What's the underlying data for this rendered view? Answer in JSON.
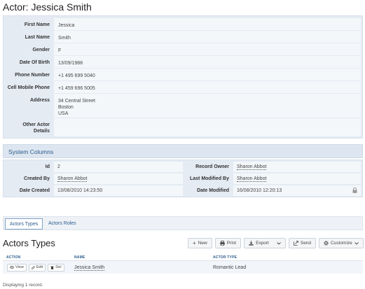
{
  "page_title": "Actor: Jessica Smith",
  "details": [
    {
      "label": "First Name",
      "value": "Jessica"
    },
    {
      "label": "Last Name",
      "value": "Smith"
    },
    {
      "label": "Gender",
      "value": "F"
    },
    {
      "label": "Date Of Birth",
      "value": "13/09/1988"
    },
    {
      "label": "Phone Number",
      "value": "+1 495 699 5040"
    },
    {
      "label": "Cell Mobile Phone",
      "value": "+1 459 696 5005"
    },
    {
      "label": "Address",
      "value_lines": [
        "34 Central Street",
        "Boston",
        "USA"
      ]
    },
    {
      "label": "Other Actor Details",
      "value": ""
    }
  ],
  "system": {
    "header": "System Columns",
    "rows": [
      {
        "label": "Id",
        "value": "2",
        "label2": "Record Owner",
        "value2": "Sharon Abbot"
      },
      {
        "label": "Created By",
        "value": "Sharon Abbot",
        "label2": "Last Modified By",
        "value2": "Sharon Abbot"
      },
      {
        "label": "Date Created",
        "value": "13/08/2010 14:23:50",
        "label2": "Date Modified",
        "value2": "16/08/2010 12:20:13"
      }
    ]
  },
  "tabs": [
    {
      "label": "Actors Types",
      "active": true
    },
    {
      "label": "Actors Roles",
      "active": false
    }
  ],
  "section_title": "Actors Types",
  "toolbar": {
    "new": "New",
    "print": "Print",
    "export": "Export",
    "send": "Send",
    "customize": "Customize"
  },
  "grid": {
    "columns": [
      "ACTION",
      "NAME",
      "ACTOR TYPE"
    ],
    "rows": [
      {
        "actions": [
          "View",
          "Edit",
          "Del"
        ],
        "name": "Jessica Smith",
        "actor_type": "Romantic Lead"
      }
    ]
  },
  "footer": "Displaying 1 record.",
  "colors": {
    "accent": "#2a5b8c",
    "panel": "#e4ebf3"
  }
}
